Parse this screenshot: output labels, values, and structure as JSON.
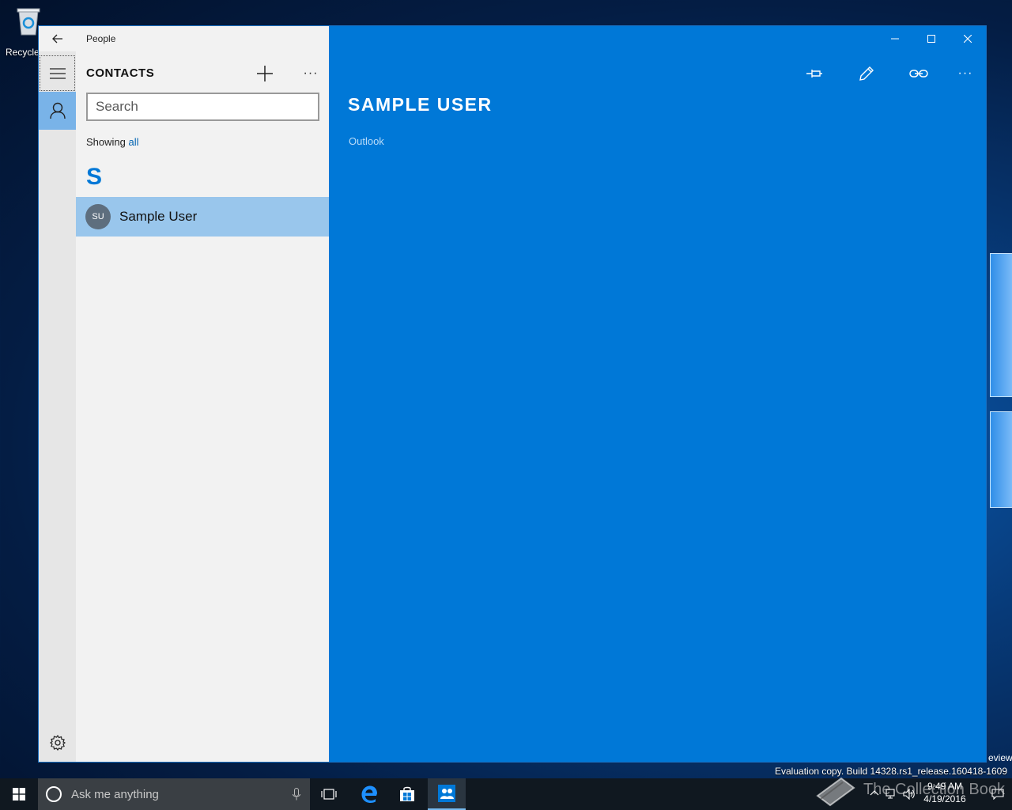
{
  "desktop": {
    "recycle_label": "Recycle...",
    "eval_text": "Evaluation copy. Build 14328.rs1_release.160418-1609",
    "preview_fragment": "eview",
    "watermark": "The Collection Book"
  },
  "app": {
    "title": "People",
    "list": {
      "heading": "CONTACTS",
      "more": "···",
      "search_placeholder": "Search",
      "showing_label": "Showing",
      "showing_filter": "all",
      "group_letter": "S",
      "contacts": [
        {
          "initials": "SU",
          "name": "Sample User"
        }
      ]
    },
    "detail": {
      "name": "SAMPLE USER",
      "source": "Outlook",
      "more": "···"
    }
  },
  "taskbar": {
    "search_placeholder": "Ask me anything",
    "time": "9:49 AM",
    "date": "4/19/2016"
  },
  "colors": {
    "accent": "#0078d7",
    "selection": "#99c6ec"
  }
}
